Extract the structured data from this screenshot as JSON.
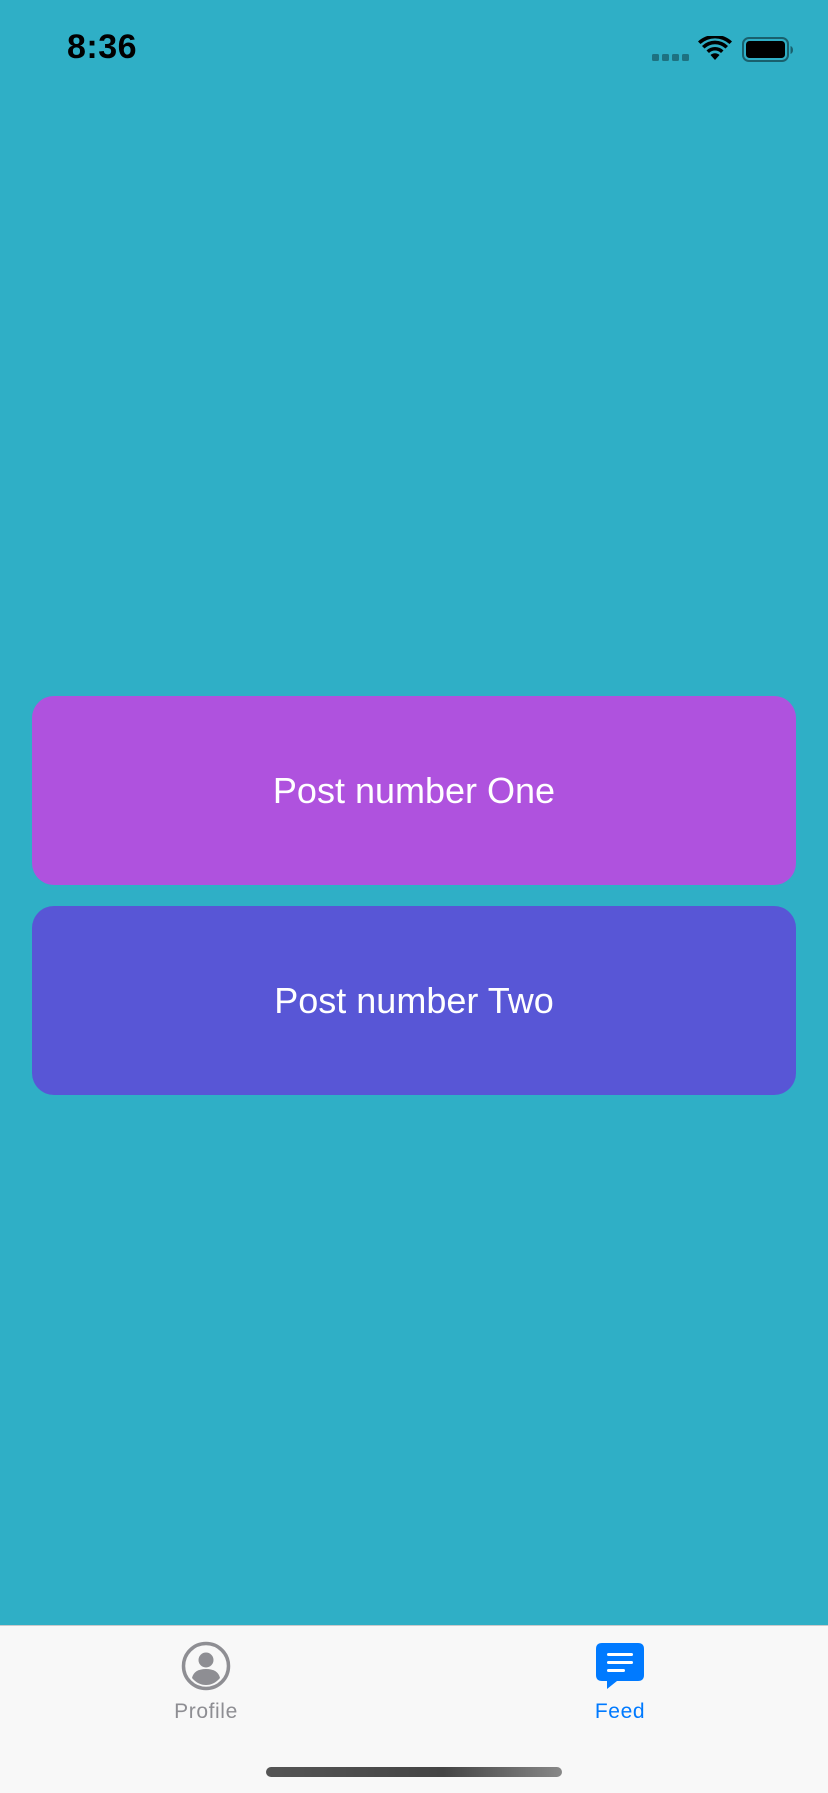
{
  "status_bar": {
    "time": "8:36",
    "signal_icon": "signal-icon",
    "wifi_icon": "wifi-icon",
    "battery_icon": "battery-icon"
  },
  "colors": {
    "background": "#2FAFC6",
    "post_one": "#AF52DE",
    "post_two": "#5856D6",
    "tab_active": "#007AFF",
    "tab_inactive": "#8E8E93",
    "tab_bar_bg": "#F8F8F8"
  },
  "posts": [
    {
      "title": "Post number One",
      "color": "#AF52DE"
    },
    {
      "title": "Post number Two",
      "color": "#5856D6"
    }
  ],
  "tab_bar": {
    "tabs": [
      {
        "label": "Profile",
        "icon": "person-circle-icon",
        "selected": false
      },
      {
        "label": "Feed",
        "icon": "message-bubble-icon",
        "selected": true
      }
    ]
  }
}
